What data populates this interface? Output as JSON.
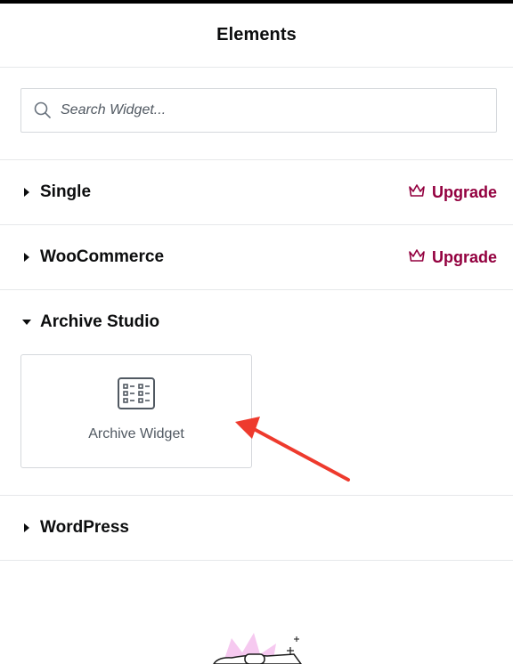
{
  "panel": {
    "title": "Elements"
  },
  "search": {
    "placeholder": "Search Widget..."
  },
  "categories": [
    {
      "label": "Single",
      "expanded": false,
      "upgrade_label": "Upgrade"
    },
    {
      "label": "WooCommerce",
      "expanded": false,
      "upgrade_label": "Upgrade"
    },
    {
      "label": "Archive Studio",
      "expanded": true,
      "widgets": [
        {
          "label": "Archive Widget",
          "icon": "archive-grid-icon"
        }
      ]
    },
    {
      "label": "WordPress",
      "expanded": false
    }
  ],
  "colors": {
    "upgrade": "#93003f",
    "annotation_arrow": "#ee3a2d",
    "border": "#e6e8ea"
  },
  "icons": {
    "search": "search-icon",
    "crown": "crown-icon",
    "caret_right": "caret-right-icon",
    "caret_down": "caret-down-icon"
  }
}
